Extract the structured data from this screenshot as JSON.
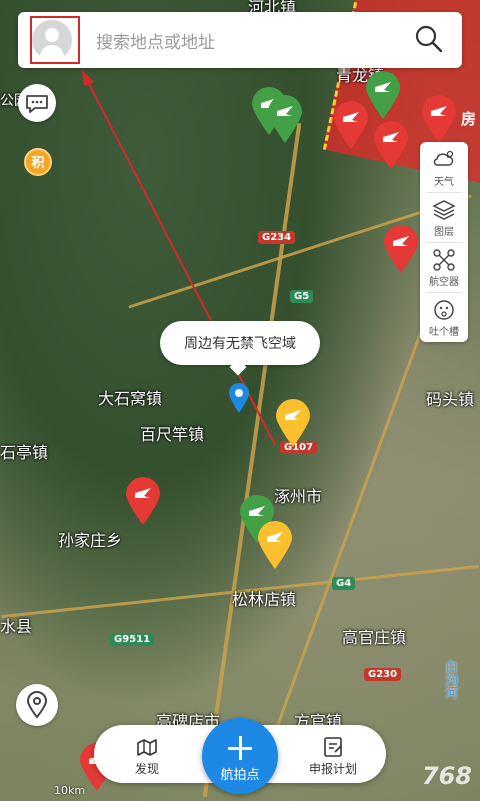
{
  "colors": {
    "accent": "#1e88e5",
    "annotation": "#d62828",
    "pin_red": "#e53935",
    "pin_green": "#43a047",
    "pin_yellow": "#fbc02d"
  },
  "search": {
    "placeholder": "搜索地点或地址"
  },
  "map": {
    "places": [
      {
        "key": "town_heshang",
        "label": "河北镇"
      },
      {
        "key": "qinglong",
        "label": "青龙镇"
      },
      {
        "key": "dashiwo",
        "label": "大石窝镇"
      },
      {
        "key": "baichigan",
        "label": "百尺竿镇"
      },
      {
        "key": "shiting",
        "label": "石亭镇"
      },
      {
        "key": "zhuozhou",
        "label": "涿州市"
      },
      {
        "key": "matou",
        "label": "码头镇"
      },
      {
        "key": "sunjiazhuang",
        "label": "孙家庄乡"
      },
      {
        "key": "songlindian",
        "label": "松林店镇"
      },
      {
        "key": "gaoguanzhuang",
        "label": "高官庄镇"
      },
      {
        "key": "shuixian",
        "label": "水县"
      },
      {
        "key": "gaobeidian",
        "label": "高碑店市"
      },
      {
        "key": "fangguan",
        "label": "方官镇"
      },
      {
        "key": "baigouhe",
        "label": "白沟河"
      },
      {
        "key": "gongyuan",
        "label": "公园"
      },
      {
        "key": "fang",
        "label": "房"
      }
    ],
    "roads": [
      {
        "key": "g234",
        "label": "G234"
      },
      {
        "key": "g5",
        "label": "G5"
      },
      {
        "key": "g107",
        "label": "G107"
      },
      {
        "key": "g4",
        "label": "G4"
      },
      {
        "key": "g9511",
        "label": "G9511"
      },
      {
        "key": "g230",
        "label": "G230"
      }
    ],
    "tooltip": "周边有无禁飞空域",
    "scale": "10km",
    "watermark": "768"
  },
  "side_buttons": {
    "jifen": "积"
  },
  "toolbar": [
    {
      "icon": "weather-icon",
      "label": "天气"
    },
    {
      "icon": "layers-icon",
      "label": "图层"
    },
    {
      "icon": "drone-icon",
      "label": "航空器"
    },
    {
      "icon": "complain-icon",
      "label": "吐个槽"
    }
  ],
  "bottom_nav": {
    "discover": "发现",
    "shoot": "航拍点",
    "report": "申报计划"
  }
}
